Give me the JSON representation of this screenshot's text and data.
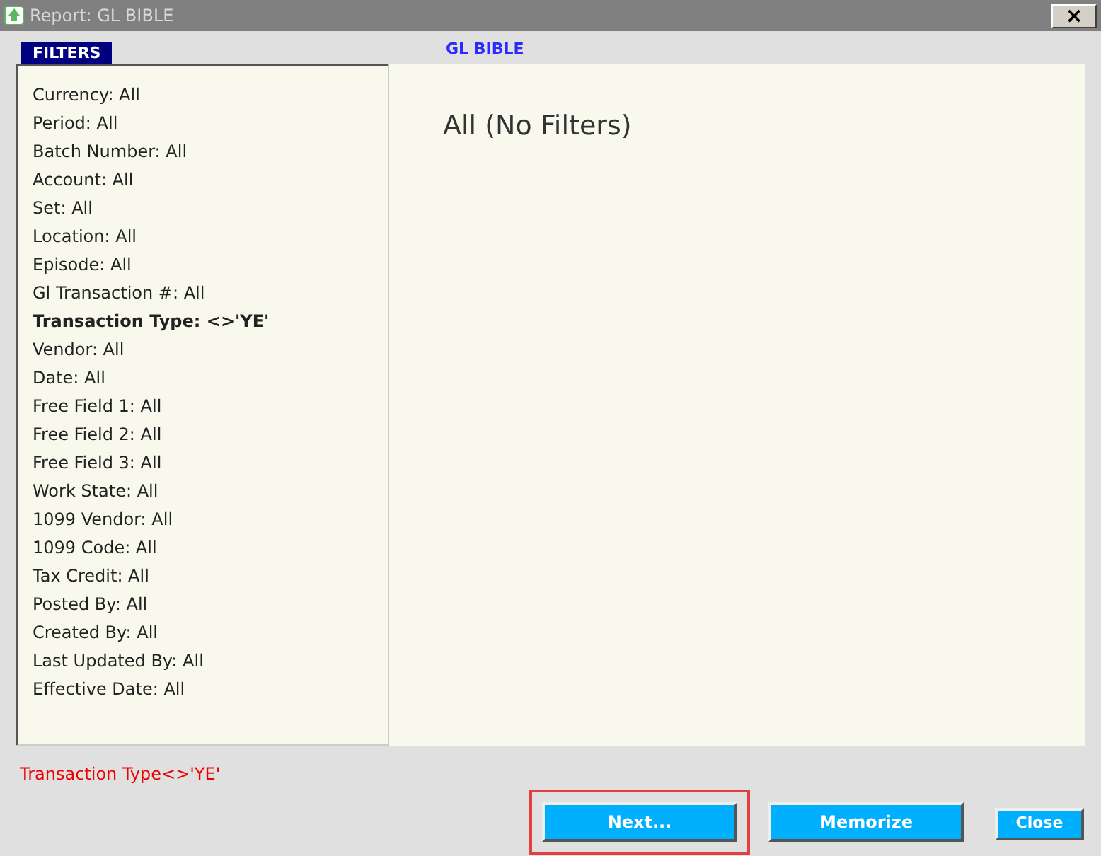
{
  "window": {
    "title": "Report: GL BIBLE",
    "close": "×"
  },
  "filters_tab": "FILTERS",
  "report_title": "GL BIBLE",
  "filters": [
    {
      "text": "Currency: All",
      "bold": false
    },
    {
      "text": "Period: All",
      "bold": false
    },
    {
      "text": "Batch Number: All",
      "bold": false
    },
    {
      "text": "Account: All",
      "bold": false
    },
    {
      "text": "Set: All",
      "bold": false
    },
    {
      "text": "Location: All",
      "bold": false
    },
    {
      "text": "Episode: All",
      "bold": false
    },
    {
      "text": "Gl Transaction #: All",
      "bold": false
    },
    {
      "text": "Transaction Type: <>'YE'",
      "bold": true
    },
    {
      "text": "Vendor: All",
      "bold": false
    },
    {
      "text": "Date: All",
      "bold": false
    },
    {
      "text": "Free Field 1: All",
      "bold": false
    },
    {
      "text": "Free Field 2: All",
      "bold": false
    },
    {
      "text": "Free Field 3: All",
      "bold": false
    },
    {
      "text": "Work State: All",
      "bold": false
    },
    {
      "text": "1099 Vendor: All",
      "bold": false
    },
    {
      "text": "1099 Code: All",
      "bold": false
    },
    {
      "text": "Tax Credit: All",
      "bold": false
    },
    {
      "text": "Posted By: All",
      "bold": false
    },
    {
      "text": "Created By: All",
      "bold": false
    },
    {
      "text": "Last Updated By: All",
      "bold": false
    },
    {
      "text": "Effective Date: All",
      "bold": false
    }
  ],
  "summary": "All (No Filters)",
  "status_text": "Transaction Type<>'YE'",
  "buttons": [
    {
      "label": "Next...",
      "focused": true,
      "kind": "wide"
    },
    {
      "label": "Memorize",
      "focused": false,
      "kind": "wide"
    },
    {
      "label": "Close",
      "focused": false,
      "kind": "compact"
    }
  ]
}
